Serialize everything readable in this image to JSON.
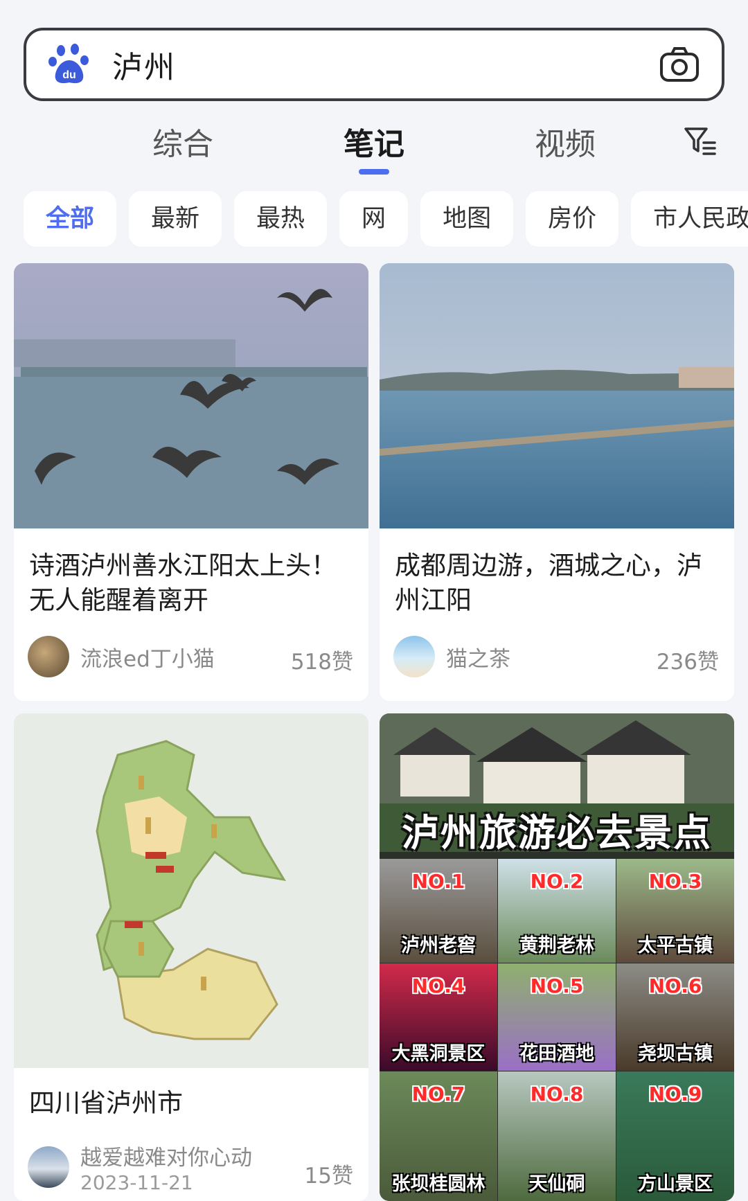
{
  "search": {
    "query": "泸州",
    "logo_icon": "baidu-paw-icon",
    "camera_icon": "camera-icon"
  },
  "tabs": [
    {
      "label": "综合",
      "active": false
    },
    {
      "label": "笔记",
      "active": true
    },
    {
      "label": "视频",
      "active": false
    }
  ],
  "filter_icon": "filter-icon",
  "accent_color": "#4e6ef2",
  "chips": [
    {
      "label": "全部",
      "active": true
    },
    {
      "label": "最新",
      "active": false
    },
    {
      "label": "最热",
      "active": false
    },
    {
      "label": "网",
      "active": false
    },
    {
      "label": "地图",
      "active": false
    },
    {
      "label": "房价",
      "active": false
    },
    {
      "label": "市人民政",
      "active": false
    }
  ],
  "cards": [
    {
      "title": "诗酒泸州善水江阳太上头！无人能醒着离开",
      "author": "流浪ed丁小猫",
      "likes": "518赞"
    },
    {
      "title": "成都周边游，酒城之心，泸州江阳",
      "author": "猫之茶",
      "likes": "236赞"
    },
    {
      "title": "四川省泸州市",
      "author": "越爱越难对你心动",
      "date": "2023-11-21",
      "likes": "15赞"
    },
    {
      "collage_title": "泸州旅游必去景点",
      "spots": [
        {
          "no": "NO.1",
          "name": "泸州老窖"
        },
        {
          "no": "NO.2",
          "name": "黄荆老林"
        },
        {
          "no": "NO.3",
          "name": "太平古镇"
        },
        {
          "no": "NO.4",
          "name": "大黑洞景区"
        },
        {
          "no": "NO.5",
          "name": "花田酒地"
        },
        {
          "no": "NO.6",
          "name": "尧坝古镇"
        },
        {
          "no": "NO.7",
          "name": "张坝桂圆林"
        },
        {
          "no": "NO.8",
          "name": "天仙硐"
        },
        {
          "no": "NO.9",
          "name": "方山景区"
        }
      ]
    }
  ]
}
